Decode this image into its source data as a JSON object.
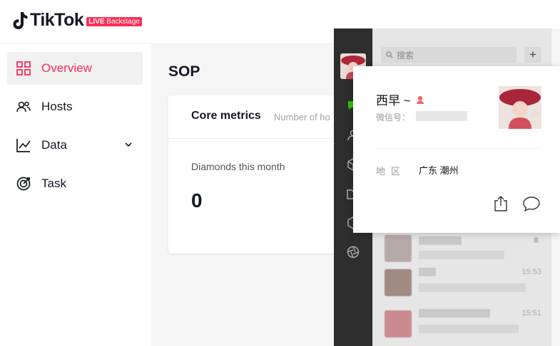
{
  "brand": {
    "name": "TikTok",
    "badge_live": "LIVE",
    "badge_text": "Backstage",
    "accent": "#fe2c55"
  },
  "sidebar": {
    "items": [
      {
        "label": "Overview",
        "icon": "grid-icon",
        "active": true
      },
      {
        "label": "Hosts",
        "icon": "users-icon"
      },
      {
        "label": "Data",
        "icon": "chart-line-icon",
        "expandable": true
      },
      {
        "label": "Task",
        "icon": "target-icon"
      }
    ]
  },
  "main": {
    "page_title": "SOP",
    "card": {
      "title": "Core metrics",
      "subtitle": "Number of ho",
      "metric_label": "Diamonds this month",
      "metric_value": "0"
    }
  },
  "wechat": {
    "search_placeholder": "搜索",
    "add_label": "+",
    "chat_times": [
      "15:53",
      "15:51"
    ],
    "popup": {
      "name": "西早 ~",
      "wxid_label": "微信号：",
      "region_label": "地区",
      "region_value": "广东 潮州"
    }
  }
}
